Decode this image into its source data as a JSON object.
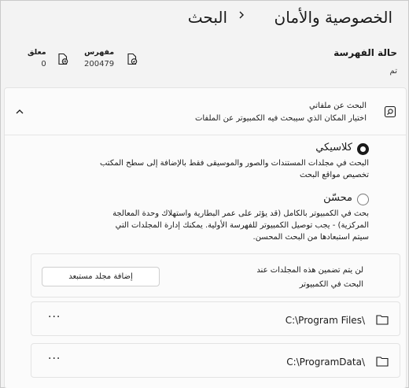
{
  "header": {
    "current_page": "الخصوصية والأمان",
    "separator": "›",
    "parent_page": "البحث"
  },
  "indexing": {
    "title": "حالة الفهرسة",
    "status": "تم",
    "indexed": {
      "label": "مفهرس",
      "value": "200479"
    },
    "paused": {
      "label": "معلق",
      "value": "0"
    }
  },
  "find_files": {
    "title": "البحث عن ملفاتي",
    "subtitle": "اختيار المكان الذي سيبحث فيه الكمبيوتر عن الملفات"
  },
  "options": {
    "classic": {
      "title": "كلاسيكي",
      "desc_line1": "البحث في مجلدات المستندات والصور والموسيقى فقط بالإضافة إلى سطح المكتب",
      "desc_line2": "تخصيص مواقع البحث",
      "selected": true
    },
    "enhanced": {
      "title": "محسّن",
      "desc_line1": "بحث في الكمبيوتر بالكامل (قد يؤثر على عمر البطارية واستهلاك وحدة المعالجة",
      "desc_line2": "المركزية) - يجب توصيل الكمبيوتر للفهرسة الأولية. يمكنك إدارة المجلدات التي",
      "desc_line3": "سيتم استبعادها من البحث المحسن.",
      "selected": false
    }
  },
  "excluded": {
    "text_line1": "لن يتم تضمين هذه المجلدات عند",
    "text_line2": "البحث في الكمبيوتر",
    "add_button": "إضافة مجلد مستبعد",
    "folders": [
      {
        "path": "C:\\Program Files\\",
        "more": "···"
      },
      {
        "path": "C:\\ProgramData\\",
        "more": "···"
      }
    ]
  }
}
